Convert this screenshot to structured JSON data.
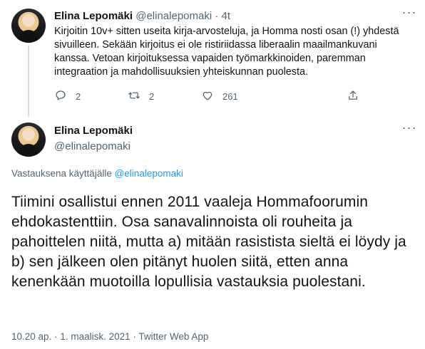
{
  "tweet1": {
    "author_name": "Elina Lepomäki",
    "handle": "@elinalepomaki",
    "separator": " · ",
    "age": "4t",
    "text": "Kirjoitin 10v+ sitten useita kirja-arvosteluja, ja Homma nosti osan (!) yhdestä sivuilleen. Sekään kirjoitus ei ole ristiriidassa liberaalin maailmankuvani kanssa. Vetoan kirjoituksessa vapaiden työmarkkinoiden, paremman integraation ja mahdollisuuksien yhteiskunnan puolesta.",
    "reply_count": "2",
    "retweet_count": "2",
    "like_count": "261",
    "icons": [
      "reply-icon",
      "retweet-icon",
      "like-icon",
      "share-icon",
      "more-icon"
    ]
  },
  "tweet2": {
    "author_name": "Elina Lepomäki",
    "handle": "@elinalepomaki",
    "replying_prefix": "Vastauksena käyttäjälle ",
    "replying_to": "@elinalepomaki",
    "text": "Tiimini osallistui ennen 2011 vaaleja Hommafoorumin ehdokastenttiin. Osa sanavalinnoista oli rouheita ja pahoittelen niitä, mutta a) mitään rasistista sieltä ei löydy ja b) sen jälkeen olen pitänyt huolen siitä, etten anna kenenkään muotoilla lopullisia vastauksia puolestani.",
    "time": "10.20 ap.",
    "dot1": " · ",
    "date": "1. maalisk. 2021",
    "dot2": " · ",
    "source": "Twitter Web App"
  },
  "colors": {
    "text": "#0f1419",
    "muted": "#536471",
    "link": "#1d9bf0",
    "thread_line": "#cfd9de"
  }
}
